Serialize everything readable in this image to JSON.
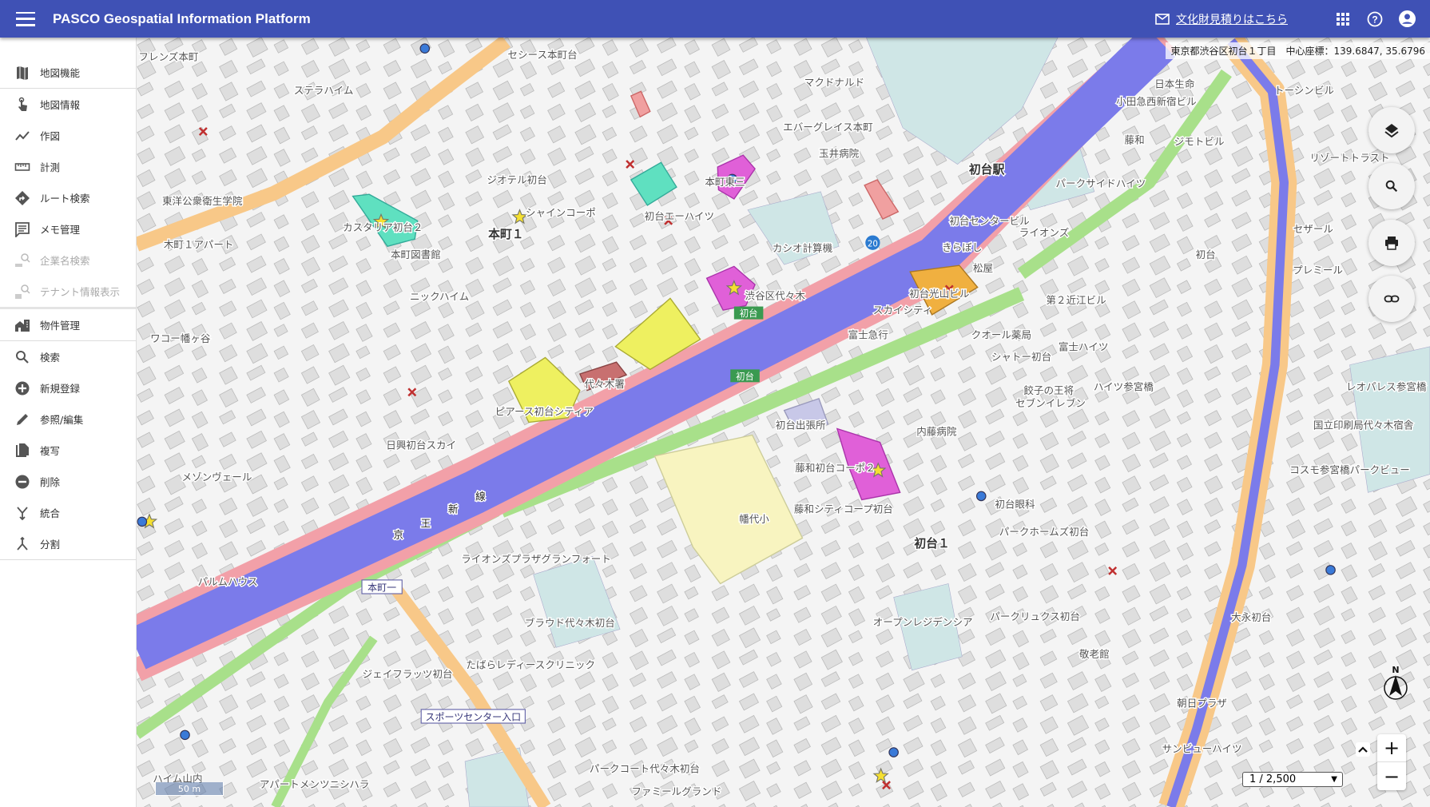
{
  "header": {
    "title": "PASCO Geospatial Information Platform",
    "estimate_link": "文化財見積りはこちら",
    "icons": [
      "menu-icon",
      "mail-icon",
      "apps-icon",
      "help-icon",
      "account-icon"
    ]
  },
  "sidebar": {
    "group1": [
      {
        "label": "地図機能",
        "icon": "map-icon"
      }
    ],
    "group2": [
      {
        "label": "地図情報",
        "icon": "touch-icon"
      },
      {
        "label": "作図",
        "icon": "line-chart-icon"
      },
      {
        "label": "計測",
        "icon": "ruler-icon"
      },
      {
        "label": "ルート検索",
        "icon": "route-icon"
      },
      {
        "label": "メモ管理",
        "icon": "memo-icon"
      },
      {
        "label": "企業名検索",
        "icon": "company-search-icon",
        "disabled": true
      },
      {
        "label": "テナント情報表示",
        "icon": "tenant-info-icon",
        "disabled": true
      }
    ],
    "group3": [
      {
        "label": "物件管理",
        "icon": "property-icon"
      }
    ],
    "group4": [
      {
        "label": "検索",
        "icon": "search-icon"
      },
      {
        "label": "新規登録",
        "icon": "add-circle-icon"
      },
      {
        "label": "参照/編集",
        "icon": "pencil-icon"
      },
      {
        "label": "複写",
        "icon": "copy-icon"
      },
      {
        "label": "削除",
        "icon": "remove-circle-icon"
      },
      {
        "label": "統合",
        "icon": "merge-icon"
      },
      {
        "label": "分割",
        "icon": "split-icon"
      }
    ]
  },
  "map": {
    "address": "東京都渋谷区初台１丁目　中心座標：139.6847, 35.6796",
    "scale": "1 / 2,500",
    "scalebar": "50 m",
    "compass_n": "N",
    "zoom_in": "+",
    "zoom_out": "−",
    "controls": [
      "layers-icon",
      "search-icon",
      "print-icon",
      "link-icon"
    ],
    "labels": [
      "フレンズ本町",
      "セシース本町台",
      "ステラハイム",
      "マクドナルド",
      "日本生命",
      "小田急西新宿ビル",
      "トーシンビル",
      "エバーグレイス本町",
      "玉井病院",
      "初台駅",
      "ジオテル初台",
      "本町東三",
      "東洋公衆衛生学院",
      "シャインコーポ",
      "初台エーハイツ",
      "カスタリア初台２",
      "本町１",
      "木町１アパート",
      "本町図書館",
      "カシオ計算機",
      "初台センタービル",
      "ライオンズ",
      "きらぼし",
      "松屋",
      "第２近江ビル",
      "ニックハイム",
      "渋谷区代々木",
      "初台光山ビル",
      "スカイシティ",
      "富士急行",
      "ワコー幡ヶ谷",
      "クオール薬局",
      "富士ハイツ",
      "シャトー初台",
      "代々木署",
      "ピアース初台シティア",
      "初台出張所",
      "内藤病院",
      "日興初台スカイ",
      "藤和初台コーポ２",
      "メゾンヴェール",
      "幡代小",
      "藤和シティコープ初台",
      "初台１",
      "初台眼科",
      "パークホームズ初台",
      "ライオンズプラザグランフォート",
      "パルムハウス",
      "ブラウド代々木初台",
      "オープンレジデンシア",
      "パークリュクス初台",
      "敬老館",
      "大永初台",
      "ジェイフラッツ初台",
      "たばらレディースクリニック",
      "朝日プラザ",
      "パークコート代々木初台",
      "ファミールグランド",
      "サンビューハイツ",
      "ハイム山内",
      "アパートメンツニシハラ",
      "国立印刷局代々木宿舎",
      "コスモ参宮橋パークビュー",
      "ハイツ参宮橋",
      "レオパレス参宮橋",
      "リゾートトラスト",
      "ジモトビル",
      "パークサイドハイツ",
      "セザール",
      "プレミール",
      "初台",
      "藤和",
      "餃子の王将",
      "セブンイレブン",
      "京",
      "王",
      "新",
      "線"
    ],
    "signs": {
      "station1": "本町一",
      "station2": "スポーツセンター入口",
      "route_a": "初台",
      "route_b": "初台",
      "route_no": "20"
    },
    "colors": {
      "highway": "#7b7bea",
      "arterial": "#f8c888",
      "green": "#a8e08a",
      "header": "#3f51b5"
    }
  }
}
